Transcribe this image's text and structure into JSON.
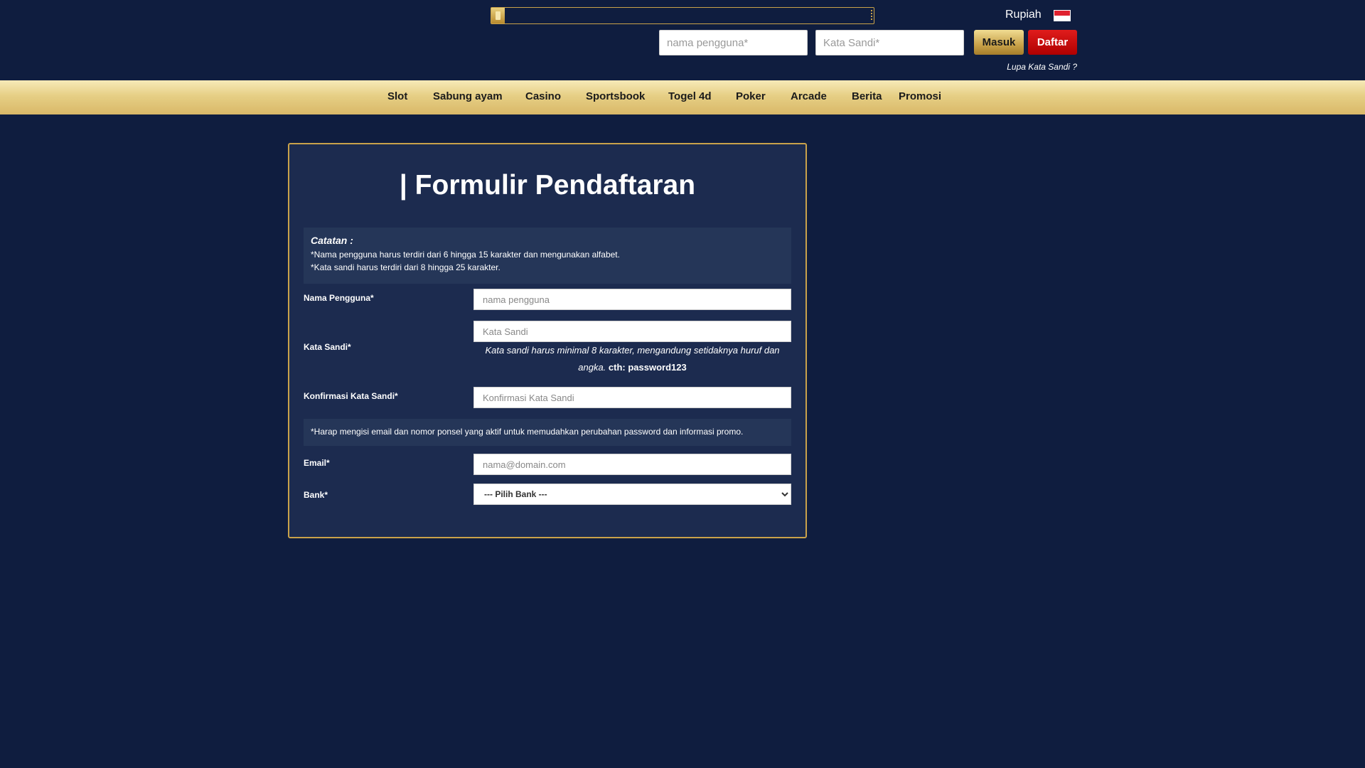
{
  "header": {
    "currency": "Rupiah",
    "flag_colors": [
      "#e0222f",
      "#ffffff"
    ],
    "username_placeholder": "nama pengguna*",
    "password_placeholder": "Kata Sandi*",
    "login_label": "Masuk",
    "register_label": "Daftar",
    "forgot_label": "Lupa Kata Sandi ?"
  },
  "nav": {
    "items": [
      "Slot",
      "Sabung ayam",
      "Casino",
      "Sportsbook",
      "Togel 4d",
      "Poker",
      "Arcade",
      "Berita",
      "Promosi"
    ]
  },
  "form": {
    "title": "| Formulir Pendaftaran",
    "note": {
      "heading": "Catatan :",
      "lines": [
        "*Nama pengguna harus terdiri dari 6 hingga 15 karakter dan mengunakan alfabet.",
        "*Kata sandi harus terdiri dari 8 hingga 25 karakter."
      ]
    },
    "username": {
      "label": "Nama Pengguna*",
      "placeholder": "nama pengguna"
    },
    "password": {
      "label": "Kata Sandi*",
      "placeholder": "Kata Sandi",
      "hint": "Kata sandi harus minimal 8 karakter, mengandung setidaknya huruf dan angka.",
      "example": "cth: password123"
    },
    "confirm": {
      "label": "Konfirmasi Kata Sandi*",
      "placeholder": "Konfirmasi Kata Sandi"
    },
    "info": "*Harap mengisi email dan nomor ponsel yang aktif untuk memudahkan perubahan password dan informasi promo.",
    "email": {
      "label": "Email*",
      "placeholder": "nama@domain.com"
    },
    "bank": {
      "label": "Bank*",
      "selected": "--- Pilih Bank ---"
    }
  },
  "colors": {
    "background": "#0f1d3f",
    "accent_gold": "#c9a24a",
    "register_red": "#c40000"
  }
}
